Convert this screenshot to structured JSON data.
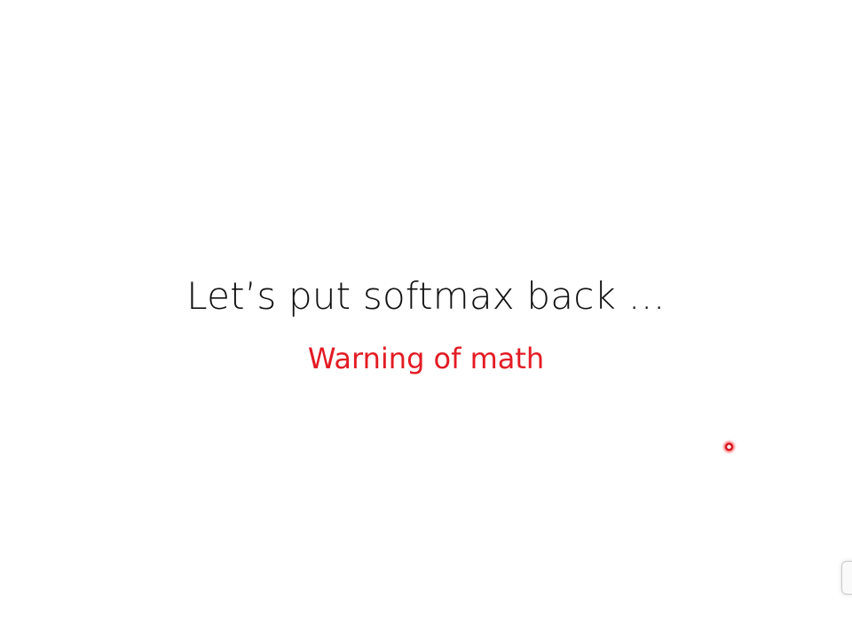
{
  "slide": {
    "title": "Let’s put softmax back …",
    "subtitle": "Warning of math",
    "subtitle_color": "#e31b23"
  },
  "pointer": {
    "icon": "laser-pointer-icon"
  }
}
